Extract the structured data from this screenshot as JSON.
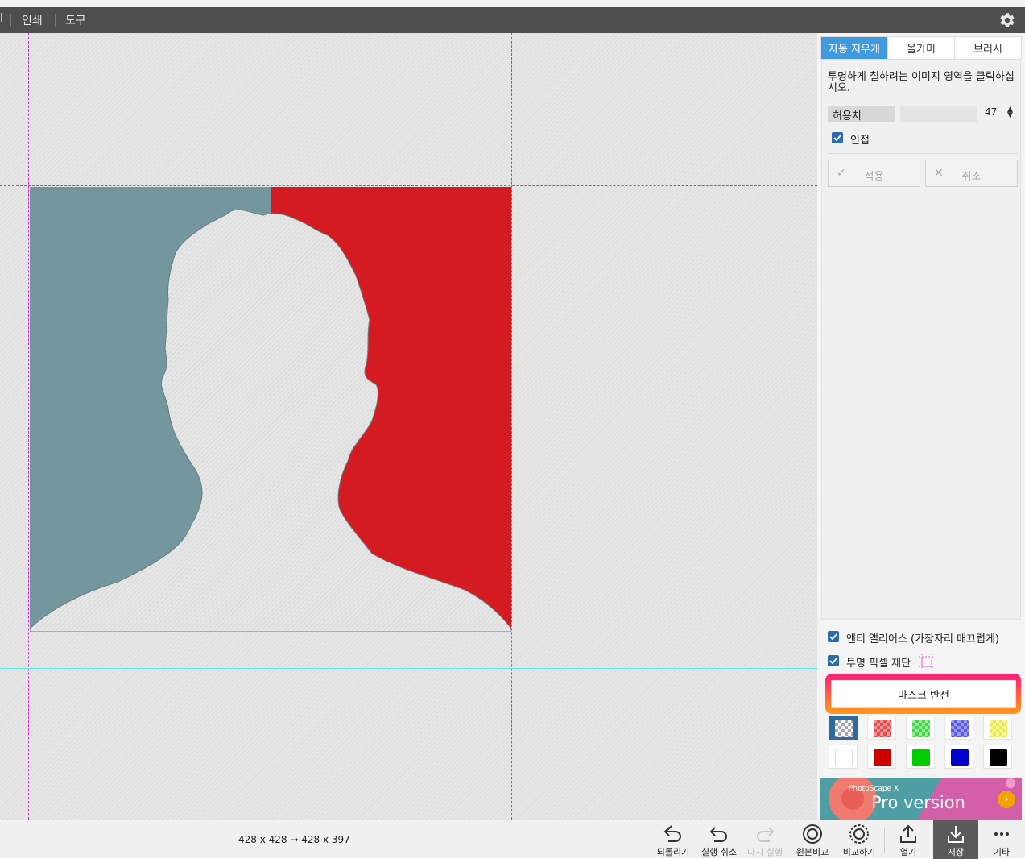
{
  "menu": {
    "partial_item": "l",
    "items": [
      "인쇄",
      "도구"
    ]
  },
  "panel": {
    "tabs": [
      "자동 지우개",
      "올가미",
      "브러시"
    ],
    "active_tab": "자동 지우개",
    "instruction": "투명하게 칠하려는 이미지 영역을 클릭하십시오.",
    "tolerance": {
      "label": "허용치",
      "value": "47"
    },
    "contiguous": {
      "label": "인접",
      "checked": true
    },
    "apply_label": "적용",
    "cancel_label": "취소",
    "antialias": {
      "label": "앤티 앨리어스 (가장자리 매끄럽게)",
      "checked": true
    },
    "trim": {
      "label": "투명 픽셀 재단",
      "checked": true
    },
    "invert_mask_label": "마스크 반전",
    "swatches_row1": [
      "checker-gray",
      "checker-red",
      "checker-green",
      "checker-blue",
      "checker-yellow"
    ],
    "swatches_row2": [
      "#ffffff",
      "#cc0000",
      "#00cc00",
      "#0000cc",
      "#000000"
    ],
    "promo": {
      "small": "PhotoScape X",
      "big": "Pro version"
    }
  },
  "canvas": {
    "left_color": "#74979f",
    "right_color": "#d41b21"
  },
  "status": {
    "dimensions": "428 x 428 → 428 x 397",
    "toolbar": [
      {
        "label": "되돌리기",
        "icon": "revert-icon"
      },
      {
        "label": "실행 취소",
        "icon": "undo-icon"
      },
      {
        "label": "다시 실행",
        "icon": "redo-icon"
      },
      {
        "label": "원본비교",
        "icon": "compare-original-icon"
      },
      {
        "label": "비교하기",
        "icon": "compare-icon"
      },
      {
        "label": "열기",
        "icon": "open-icon"
      },
      {
        "label": "저장",
        "icon": "save-icon"
      },
      {
        "label": "기타",
        "icon": "more-icon"
      }
    ]
  }
}
